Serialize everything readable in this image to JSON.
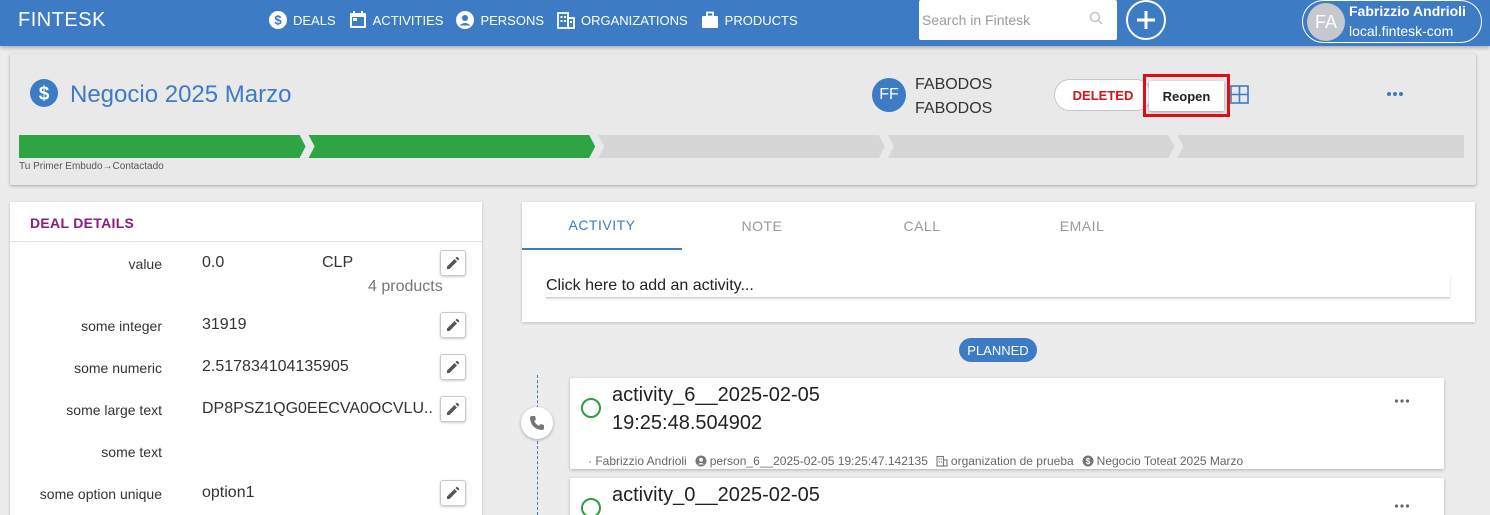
{
  "app": {
    "brand": "FINTESK"
  },
  "nav": [
    {
      "label": "DEALS",
      "icon": "dollar-icon"
    },
    {
      "label": "ACTIVITIES",
      "icon": "calendar-icon"
    },
    {
      "label": "PERSONS",
      "icon": "person-icon"
    },
    {
      "label": "ORGANIZATIONS",
      "icon": "building-icon"
    },
    {
      "label": "PRODUCTS",
      "icon": "briefcase-icon"
    }
  ],
  "search": {
    "placeholder": "Search in Fintesk"
  },
  "user": {
    "initials": "FA",
    "name": "Fabrizzio Andrioli",
    "host": "local.fintesk-com"
  },
  "deal": {
    "title": "Negocio 2025 Marzo",
    "owner_initials": "FF",
    "owner_name": "FABODOS FABODOS",
    "status_badge": "DELETED",
    "reopen_label": "Reopen",
    "stage_label": "Tu Primer Embudo→Contactado",
    "pipeline": {
      "stages_total": 5,
      "stages_completed": 2
    }
  },
  "details": {
    "heading": "DEAL DETAILS",
    "value": {
      "label": "value",
      "amount": "0.0",
      "currency": "CLP",
      "products": "4 products"
    },
    "fields": [
      {
        "label": "some integer",
        "value": "31919",
        "editable": true
      },
      {
        "label": "some numeric",
        "value": "2.517834104135905",
        "editable": true
      },
      {
        "label": "some large text",
        "value": "DP8PSZ1QG0EECVA0OCVLU..",
        "editable": true
      },
      {
        "label": "some text",
        "value": "",
        "editable": false
      },
      {
        "label": "some option unique",
        "value": "option1",
        "editable": true
      }
    ]
  },
  "activity": {
    "tabs": [
      "ACTIVITY",
      "NOTE",
      "CALL",
      "EMAIL"
    ],
    "active_tab": "ACTIVITY",
    "input_placeholder": "Click here to add an activity...",
    "planned_label": "PLANNED",
    "items": [
      {
        "title": "activity_6__2025-02-05 19:25:48.504902",
        "owner": "· Fabrizzio Andrioli",
        "person": "person_6__2025-02-05 19:25:47.142135",
        "organization": "organization de prueba",
        "deal": "Negocio Toteat 2025 Marzo"
      },
      {
        "title": "activity_0__2025-02-05"
      }
    ]
  },
  "colors": {
    "primary": "#3d7bc4",
    "deleted": "#d0141c",
    "highlight": "#e30c14",
    "pipeline_done": "#2ea442",
    "pipeline_todo": "#d6d6d6"
  }
}
